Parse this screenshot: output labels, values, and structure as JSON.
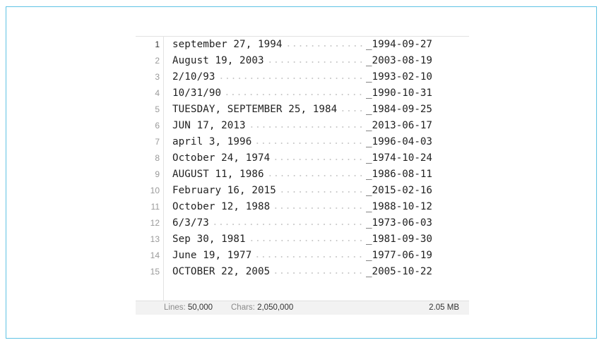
{
  "lines": [
    {
      "num": "1",
      "text": "september 27, 1994",
      "result": "_1994-09-27"
    },
    {
      "num": "2",
      "text": "August 19, 2003",
      "result": "_2003-08-19"
    },
    {
      "num": "3",
      "text": "2/10/93",
      "result": "_1993-02-10"
    },
    {
      "num": "4",
      "text": "10/31/90",
      "result": "_1990-10-31"
    },
    {
      "num": "5",
      "text": "TUESDAY, SEPTEMBER 25, 1984",
      "result": "_1984-09-25"
    },
    {
      "num": "6",
      "text": "JUN 17, 2013",
      "result": "_2013-06-17"
    },
    {
      "num": "7",
      "text": "april 3, 1996",
      "result": "_1996-04-03"
    },
    {
      "num": "8",
      "text": "October 24, 1974",
      "result": "_1974-10-24"
    },
    {
      "num": "9",
      "text": "AUGUST 11, 1986",
      "result": "_1986-08-11"
    },
    {
      "num": "10",
      "text": "February 16, 2015",
      "result": "_2015-02-16"
    },
    {
      "num": "11",
      "text": "October 12, 1988",
      "result": "_1988-10-12"
    },
    {
      "num": "12",
      "text": "6/3/73",
      "result": "_1973-06-03"
    },
    {
      "num": "13",
      "text": "Sep 30, 1981",
      "result": "_1981-09-30"
    },
    {
      "num": "14",
      "text": "June 19, 1977",
      "result": "_1977-06-19"
    },
    {
      "num": "15",
      "text": "OCTOBER 22, 2005",
      "result": "_2005-10-22"
    }
  ],
  "status": {
    "lines_label": "Lines:",
    "lines_value": "50,000",
    "chars_label": "Chars:",
    "chars_value": "2,050,000",
    "size": "2.05 MB"
  },
  "colors": {
    "frame_border": "#5fc3e4",
    "text": "#222222",
    "gutter_text": "#9a9a9a",
    "statusbar_bg": "#f2f2f2"
  }
}
